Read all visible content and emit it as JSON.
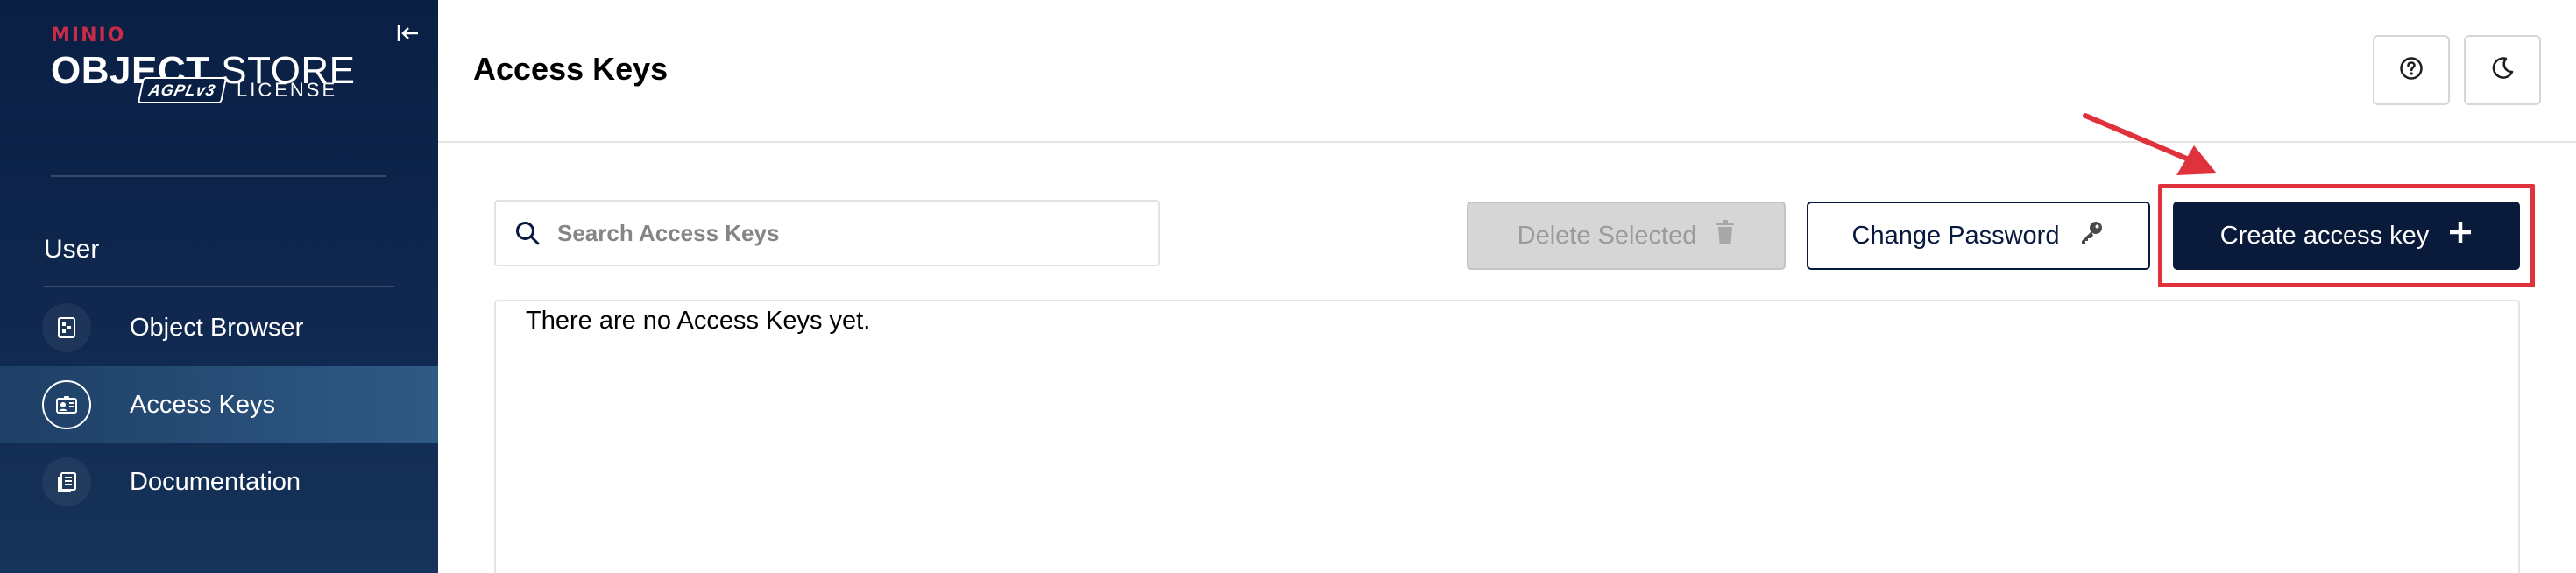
{
  "sidebar": {
    "brand": "MINIO",
    "product_strong": "OBJECT",
    "product_light": "STORE",
    "badge": "AGPLv3",
    "license": "LICENSE",
    "section_title": "User",
    "items": [
      {
        "label": "Object Browser",
        "icon": "object-browser-icon",
        "active": false
      },
      {
        "label": "Access Keys",
        "icon": "access-keys-icon",
        "active": true
      },
      {
        "label": "Documentation",
        "icon": "documentation-icon",
        "active": false
      }
    ]
  },
  "header": {
    "title": "Access Keys",
    "help_icon": "help-icon",
    "theme_icon": "moon-icon"
  },
  "toolbar": {
    "search_placeholder": "Search Access Keys",
    "delete_label": "Delete Selected",
    "change_password_label": "Change Password",
    "create_label": "Create access key"
  },
  "table": {
    "empty_message": "There are no Access Keys yet."
  },
  "colors": {
    "sidebar_bg": "#0a1f44",
    "brand_red": "#c72c48",
    "primary_button": "#0a1a3a",
    "annotation": "#e0323c"
  }
}
